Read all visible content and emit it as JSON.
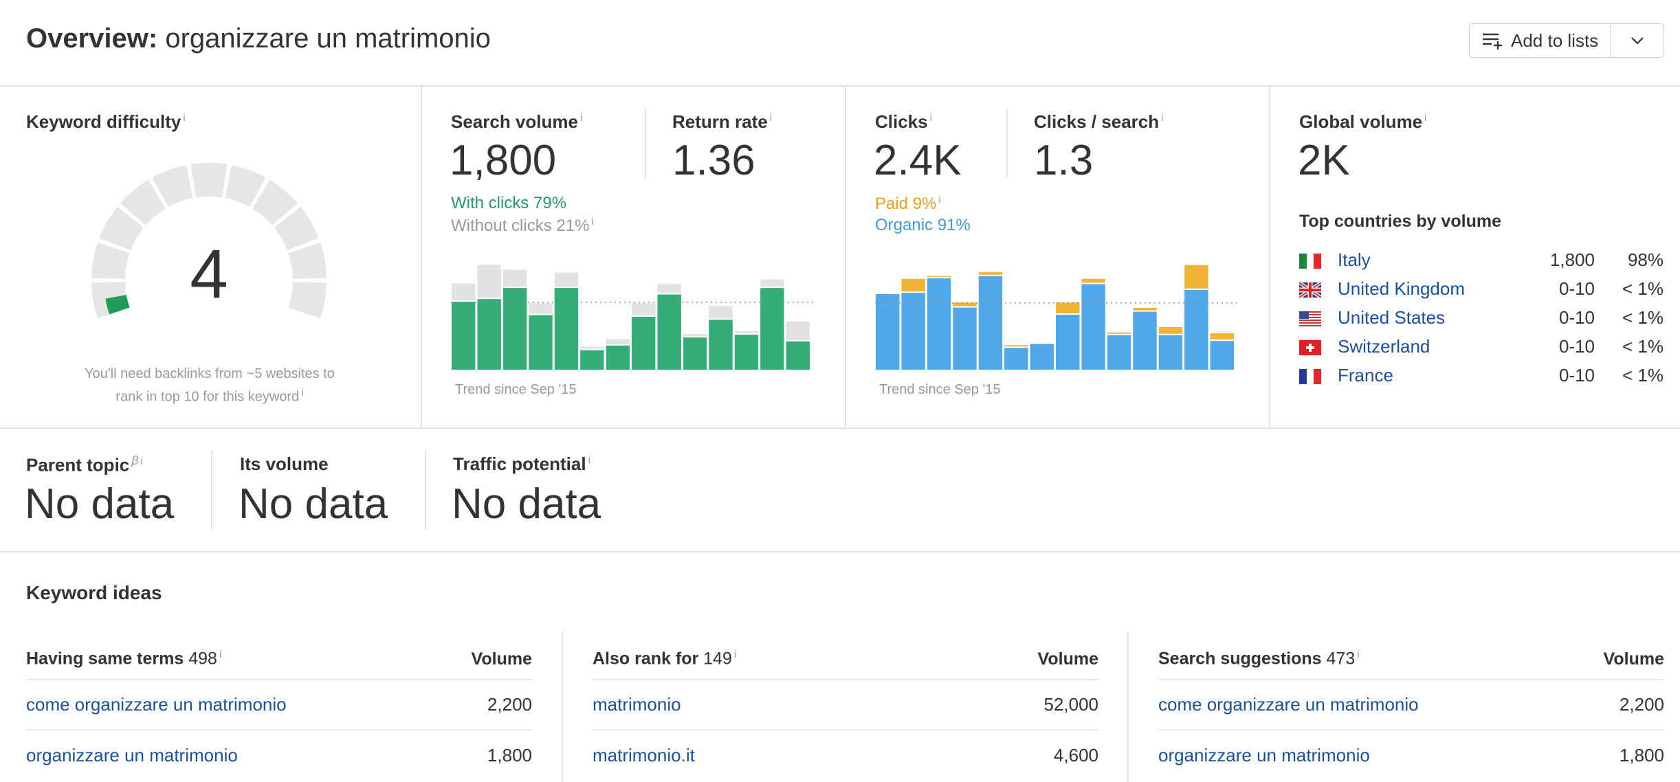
{
  "header": {
    "title_prefix": "Overview:",
    "keyword": "organizzare un matrimonio",
    "add_to_lists": "Add to lists"
  },
  "difficulty": {
    "label": "Keyword difficulty",
    "value": "4",
    "score": 4,
    "note_line1": "You'll need backlinks from ~5 websites to",
    "note_line2": "rank in top 10 for this keyword",
    "colors": {
      "indicator": "#1d9c5c",
      "track": "#e6e6e6"
    }
  },
  "search_volume": {
    "label": "Search volume",
    "value": "1,800",
    "with_clicks": "With clicks 79%",
    "without_clicks": "Without clicks 21%",
    "trend": "Trend since Sep '15"
  },
  "return_rate": {
    "label": "Return rate",
    "value": "1.36"
  },
  "clicks": {
    "label": "Clicks",
    "value": "2.4K",
    "paid": "Paid 9%",
    "organic": "Organic 91%",
    "trend": "Trend since Sep '15"
  },
  "clicks_per_search": {
    "label": "Clicks / search",
    "value": "1.3"
  },
  "global_volume": {
    "label": "Global volume",
    "value": "2K",
    "top_countries_label": "Top countries by volume",
    "countries": [
      {
        "name": "Italy",
        "flag": "it-flag",
        "volume": "1,800",
        "share": "98%"
      },
      {
        "name": "United Kingdom",
        "flag": "gb-flag",
        "volume": "0-10",
        "share": "< 1%"
      },
      {
        "name": "United States",
        "flag": "us-flag",
        "volume": "0-10",
        "share": "< 1%"
      },
      {
        "name": "Switzerland",
        "flag": "ch-flag",
        "volume": "0-10",
        "share": "< 1%"
      },
      {
        "name": "France",
        "flag": "fr-flag",
        "volume": "0-10",
        "share": "< 1%"
      }
    ]
  },
  "parent_topic": {
    "label": "Parent topic",
    "beta": "β",
    "value": "No data"
  },
  "its_volume": {
    "label": "Its volume",
    "value": "No data"
  },
  "traffic_potential": {
    "label": "Traffic potential",
    "value": "No data"
  },
  "keyword_ideas": {
    "title": "Keyword ideas",
    "volume_header": "Volume",
    "columns": [
      {
        "label": "Having same terms",
        "count": "498",
        "rows": [
          {
            "kw": "come organizzare un matrimonio",
            "vol": "2,200"
          },
          {
            "kw": "organizzare un matrimonio",
            "vol": "1,800"
          }
        ]
      },
      {
        "label": "Also rank for",
        "count": "149",
        "rows": [
          {
            "kw": "matrimonio",
            "vol": "52,000"
          },
          {
            "kw": "matrimonio.it",
            "vol": "4,600"
          }
        ]
      },
      {
        "label": "Search suggestions",
        "count": "473",
        "rows": [
          {
            "kw": "come organizzare un matrimonio",
            "vol": "2,200"
          },
          {
            "kw": "organizzare un matrimonio",
            "vol": "1,800"
          }
        ]
      }
    ]
  },
  "chart_data": [
    {
      "type": "bar",
      "stacked": true,
      "note": "relative heights, no axis",
      "series": [
        {
          "name": "With clicks",
          "color": "#35ad79",
          "values": [
            295,
            307,
            355,
            237,
            355,
            85,
            105,
            230,
            327,
            140,
            217,
            152,
            355,
            123
          ]
        },
        {
          "name": "Without clicks",
          "color": "#e2e2e2",
          "values": [
            80,
            150,
            80,
            53,
            67,
            15,
            28,
            60,
            46,
            15,
            60,
            16,
            37,
            87
          ]
        }
      ],
      "average": 293,
      "xlabel": "Trend since Sep '15"
    },
    {
      "type": "bar",
      "stacked": true,
      "note": "relative heights, no axis",
      "series": [
        {
          "name": "Organic",
          "color": "#4fa8ea",
          "values": [
            329,
            334,
            397,
            270,
            407,
            95,
            112,
            239,
            372,
            150,
            252,
            150,
            347,
            125
          ]
        },
        {
          "name": "Paid",
          "color": "#f0b537",
          "values": [
            0,
            61,
            10,
            22,
            18,
            12,
            0,
            53,
            23,
            12,
            17,
            35,
            108,
            33
          ]
        }
      ],
      "average": 290,
      "xlabel": "Trend since Sep '15"
    }
  ]
}
